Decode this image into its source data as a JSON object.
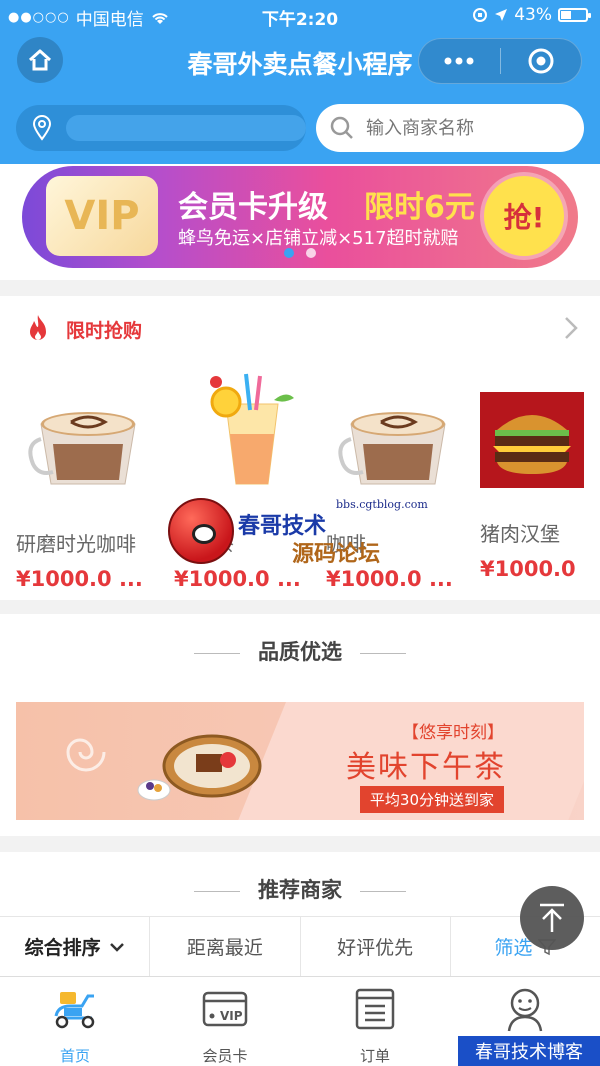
{
  "status_bar": {
    "carrier": "中国电信",
    "time": "下午2:20",
    "battery_text": "43%",
    "battery_level": 0.43
  },
  "nav": {
    "title": "春哥外卖点餐小程序",
    "home_icon": "home-icon",
    "more_icon": "more-dots-icon",
    "close_icon": "target-circle-icon"
  },
  "search": {
    "placeholder": "输入商家名称",
    "location_icon": "location-pin-icon"
  },
  "banner": {
    "vip_text": "VIP",
    "title": "会员卡升级",
    "price_text": "限时6元",
    "subtitle": "蜂鸟免运×店铺立减×517超时就赔",
    "grab_label": "抢!",
    "dots": [
      true,
      false
    ]
  },
  "flash_sale": {
    "title": "限时抢购",
    "products": [
      {
        "name": "研磨时光咖啡",
        "price": "¥1000.0 ..."
      },
      {
        "name": "柠檬茶",
        "price": "¥1000.0 ..."
      },
      {
        "name": "咖啡",
        "price": "¥1000.0 ..."
      },
      {
        "name": "猪肉汉堡",
        "price": "¥1000.0"
      }
    ]
  },
  "quality": {
    "title": "品质优选",
    "promo_tag": "【悠享时刻】",
    "promo_title": "美味下午茶",
    "promo_sub": "平均30分钟送到家"
  },
  "recommend": {
    "title": "推荐商家",
    "sort": [
      "综合排序",
      "距离最近",
      "好评优先",
      "筛选"
    ]
  },
  "tabs": [
    {
      "label": "首页",
      "active": true
    },
    {
      "label": "会员卡",
      "active": false
    },
    {
      "label": "订单",
      "active": false
    },
    {
      "label": "我的",
      "active": false
    }
  ],
  "watermark": {
    "url": "bbs.cgtblog.com",
    "line1": "春哥技术",
    "line2": "源码论坛",
    "corner": "春哥技术博客"
  },
  "colors": {
    "primary": "#3aa3f2",
    "price_red": "#e5383b"
  }
}
